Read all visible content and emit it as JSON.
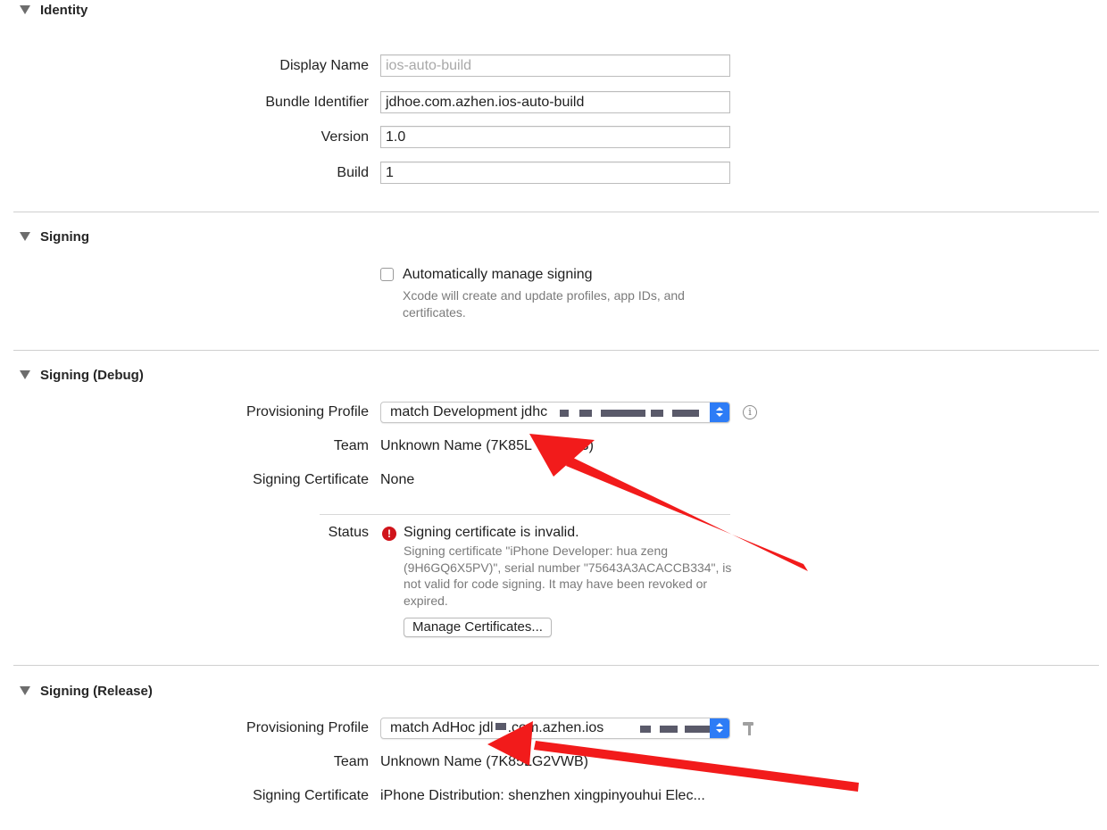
{
  "identity": {
    "title": "Identity",
    "display_name_label": "Display Name",
    "display_name_placeholder": "ios-auto-build",
    "bundle_identifier_label": "Bundle Identifier",
    "bundle_identifier_value": "jdhoe.com.azhen.ios-auto-build",
    "version_label": "Version",
    "version_value": "1.0",
    "build_label": "Build",
    "build_value": "1"
  },
  "signing": {
    "title": "Signing",
    "auto_manage_label": "Automatically manage signing",
    "auto_manage_checked": false,
    "auto_manage_help": "Xcode will create and update profiles, app IDs, and certificates."
  },
  "signing_debug": {
    "title": "Signing (Debug)",
    "profile_label": "Provisioning Profile",
    "profile_value": "match Development jdhc",
    "team_label": "Team",
    "team_value": "Unknown Name (7K85L",
    "team_value_tail": "WB)",
    "cert_label": "Signing Certificate",
    "cert_value": "None",
    "status_label": "Status",
    "status_title": "Signing certificate is invalid.",
    "status_detail": "Signing certificate \"iPhone Developer: hua zeng (9H6GQ6X5PV)\", serial number \"75643A3ACACCB334\", is not valid for code signing. It may have been revoked or expired.",
    "manage_button": "Manage Certificates..."
  },
  "signing_release": {
    "title": "Signing (Release)",
    "profile_label": "Provisioning Profile",
    "profile_value": "match AdHoc jdl",
    "profile_value_tail": ".com.azhen.ios",
    "team_label": "Team",
    "team_value": "Unknown Name (7K85LG2VWB)",
    "cert_label": "Signing Certificate",
    "cert_value": "iPhone Distribution: shenzhen xingpinyouhui Elec..."
  },
  "colors": {
    "accent_blue": "#2d7cf6",
    "error_red": "#d0141b",
    "annotation_red": "#f21b1b"
  },
  "icons": [
    "disclosure-triangle-icon",
    "popup-arrows-icon",
    "info-icon",
    "error-icon",
    "hammer-icon"
  ]
}
